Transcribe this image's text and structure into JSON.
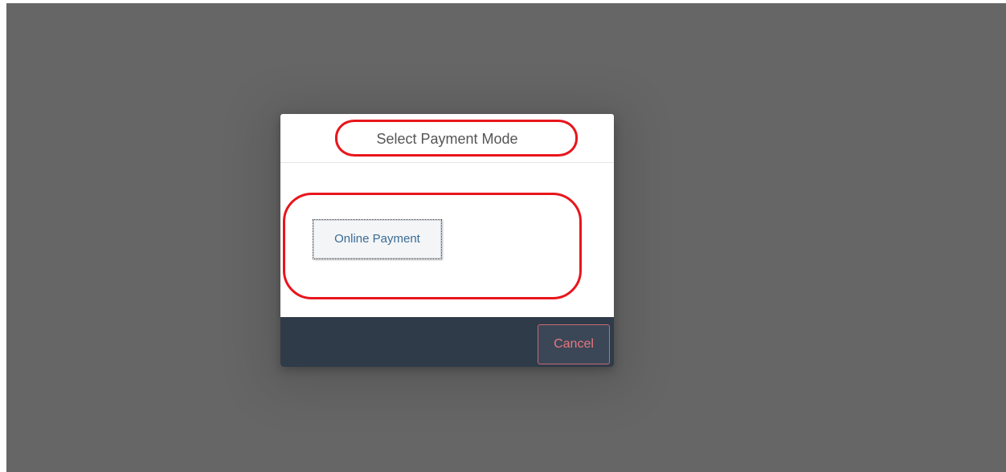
{
  "modal": {
    "title": "Select Payment Mode",
    "online_payment_label": "Online Payment",
    "cancel_label": "Cancel"
  },
  "colors": {
    "backdrop": "#666666",
    "footer": "#2f3b48",
    "annotation": "#e8161c",
    "cancel_text": "#e8767e",
    "button_text": "#3b6b94"
  }
}
